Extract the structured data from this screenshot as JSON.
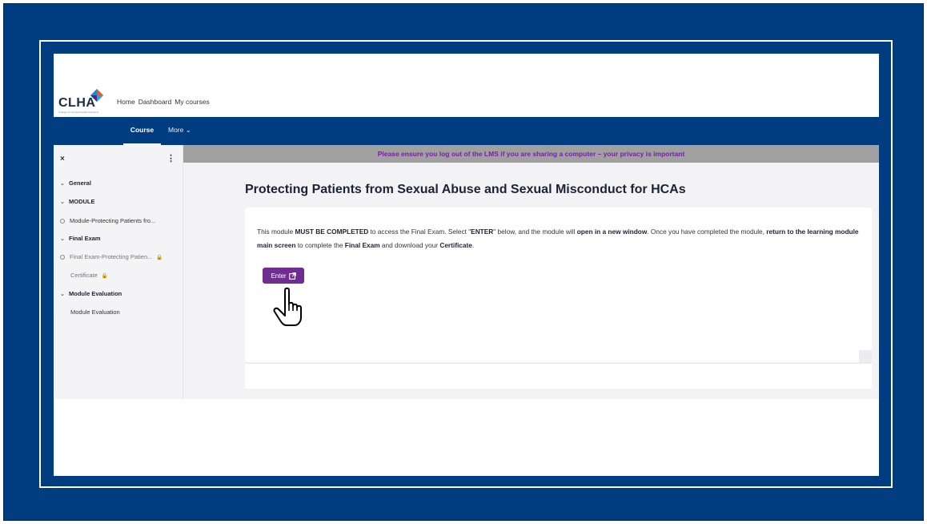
{
  "logo": {
    "text": "CLHA",
    "tagline": "College of Licensed Health Assistants"
  },
  "topnav": {
    "items": [
      "Home",
      "Dashboard",
      "My courses"
    ]
  },
  "navbar": {
    "course": "Course",
    "more": "More"
  },
  "sidebar": {
    "close": "×",
    "menu": "⋮",
    "items": [
      {
        "label": "General",
        "type": "section"
      },
      {
        "label": "MODULE",
        "type": "section"
      },
      {
        "label": "Module-Protecting Patients fro...",
        "type": "activity"
      },
      {
        "label": "Final Exam",
        "type": "section"
      },
      {
        "label": "Final Exam-Protecting Patien...",
        "type": "activity-locked"
      },
      {
        "label": "Certificate",
        "type": "locked"
      },
      {
        "label": "Module Evaluation",
        "type": "section"
      },
      {
        "label": "Module Evaluation",
        "type": "plain"
      }
    ]
  },
  "banner": "Please ensure you log out of the LMS if you are sharing a computer – your privacy is important",
  "page": {
    "title": "Protecting Patients from Sexual Abuse and Sexual Misconduct for HCAs",
    "text": {
      "p1": "This module ",
      "b1": "MUST BE COMPLETED",
      "p2": " to access the Final Exam. Select \"",
      "b2": "ENTER",
      "p3": "\" below, and the module will ",
      "b3": "open in a new window",
      "p4": ". Once you have completed the module, ",
      "b4": "return to the learning module main screen",
      "p5": " to complete the ",
      "b5": "Final Exam",
      "p6": " and download your ",
      "b6": "Certificate",
      "p7": "."
    },
    "enter_label": "Enter"
  },
  "colors": {
    "brand": "#003d80",
    "accent": "#6f2d91",
    "banner_text": "#7a1fa6"
  }
}
